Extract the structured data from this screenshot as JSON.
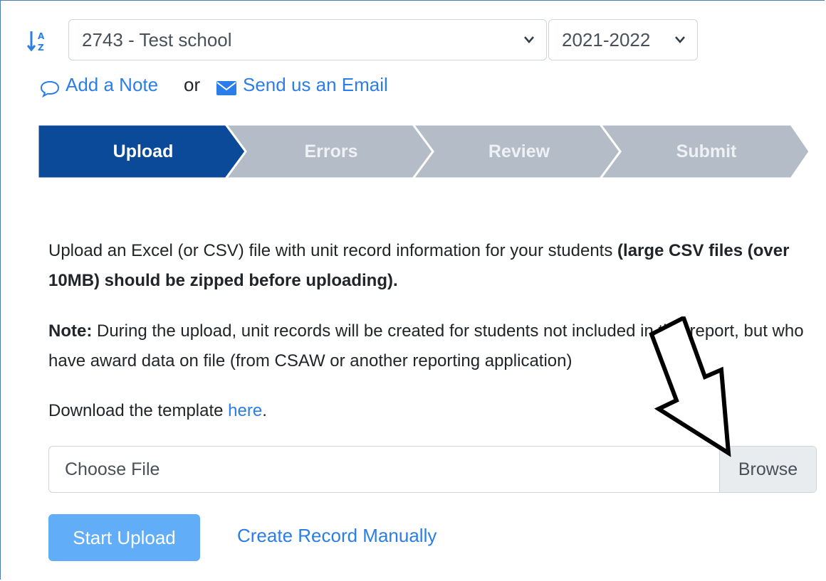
{
  "filters": {
    "sort_icon": "sort-alpha-down-icon",
    "school": "2743 - Test school",
    "year": "2021-2022"
  },
  "actions": {
    "add_note": "Add a Note",
    "or": "or",
    "send_email": "Send us an Email"
  },
  "steps": [
    {
      "label": "Upload",
      "active": true
    },
    {
      "label": "Errors",
      "active": false
    },
    {
      "label": "Review",
      "active": false
    },
    {
      "label": "Submit",
      "active": false
    }
  ],
  "instructions": {
    "intro": "Upload an Excel (or CSV) file with unit record information for your students ",
    "intro_bold": "(large CSV files (over 10MB) should be zipped before uploading).",
    "note_label": "Note:",
    "note_text": " During the upload, unit records will be created for students not included in this report, but who have award data on file (from CSAW or another reporting application)",
    "download_prefix": "Download the template ",
    "download_link": "here",
    "download_suffix": "."
  },
  "file_input": {
    "placeholder": "Choose File",
    "browse": "Browse"
  },
  "buttons": {
    "start_upload": "Start Upload",
    "create_manual": "Create Record Manually"
  },
  "colors": {
    "step_active": "#0b4a99",
    "step_inactive": "#b3bcc7",
    "link": "#2b7de9",
    "primary_button": "#61adf7"
  }
}
